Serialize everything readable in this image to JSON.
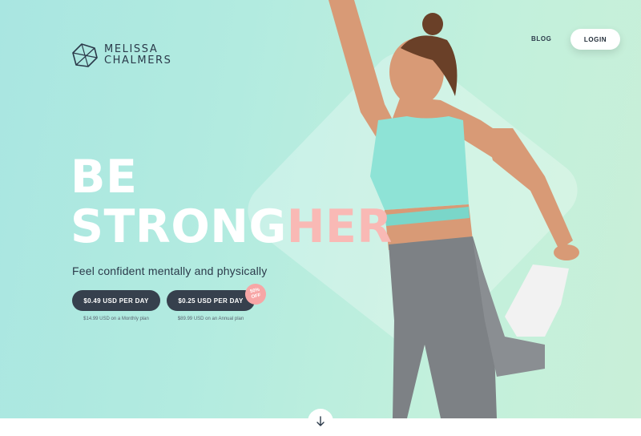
{
  "brand": {
    "name_line1": "MELISSA",
    "name_line2": "CHALMERS"
  },
  "nav": {
    "blog_label": "BLOG",
    "login_label": "LOGIN"
  },
  "hero": {
    "headline_line1": "BE",
    "headline_line2_main": "STRONG",
    "headline_line2_accent": "HER",
    "tagline": "Feel confident mentally and physically"
  },
  "plans": [
    {
      "button_label": "$0.49 USD PER DAY",
      "note": "$14.99 USD on a Monthly plan"
    },
    {
      "button_label": "$0.25 USD PER DAY",
      "note": "$89.99 USD on an Annual plan"
    }
  ],
  "badge": {
    "line1": "50%",
    "line2": "OFF"
  },
  "icons": {
    "logo": "geometric-logo-icon",
    "scroll": "arrow-down-icon"
  },
  "colors": {
    "accent": "#f9b9b5",
    "button_dark": "#36404d",
    "text_dark": "#2b3a4a"
  }
}
